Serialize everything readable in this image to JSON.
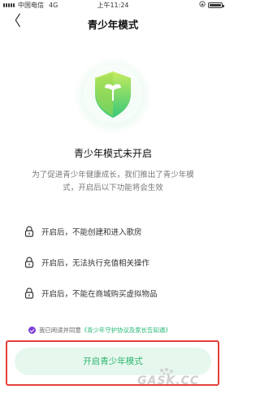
{
  "status_bar": {
    "carrier": "中国电信",
    "network": "4G",
    "time": "上午11:24"
  },
  "nav": {
    "back_glyph": "〈",
    "title": "青少年模式"
  },
  "hero": {
    "icon": "shield-leaf-icon"
  },
  "mode_status": "青少年模式未开启",
  "description": "为了促进青少年健康成长，我们推出了青少年模式，开启后以下功能将会生效",
  "restrictions": [
    "开启后，不能创建和进入歌房",
    "开启后，无法执行充值相关操作",
    "开启后，不能在商城购买虚拟物品"
  ],
  "agreement": {
    "prefix": "我已阅读并同意",
    "link": "《青少年守护协议及家长告知通》"
  },
  "cta_label": "开启青少年模式",
  "watermark": "GASK.CC",
  "colors": {
    "accent_green": "#2fb56e",
    "button_bg": "#e6f8ee",
    "checkbox": "#7b3ed8",
    "highlight_border": "#e5403a"
  }
}
